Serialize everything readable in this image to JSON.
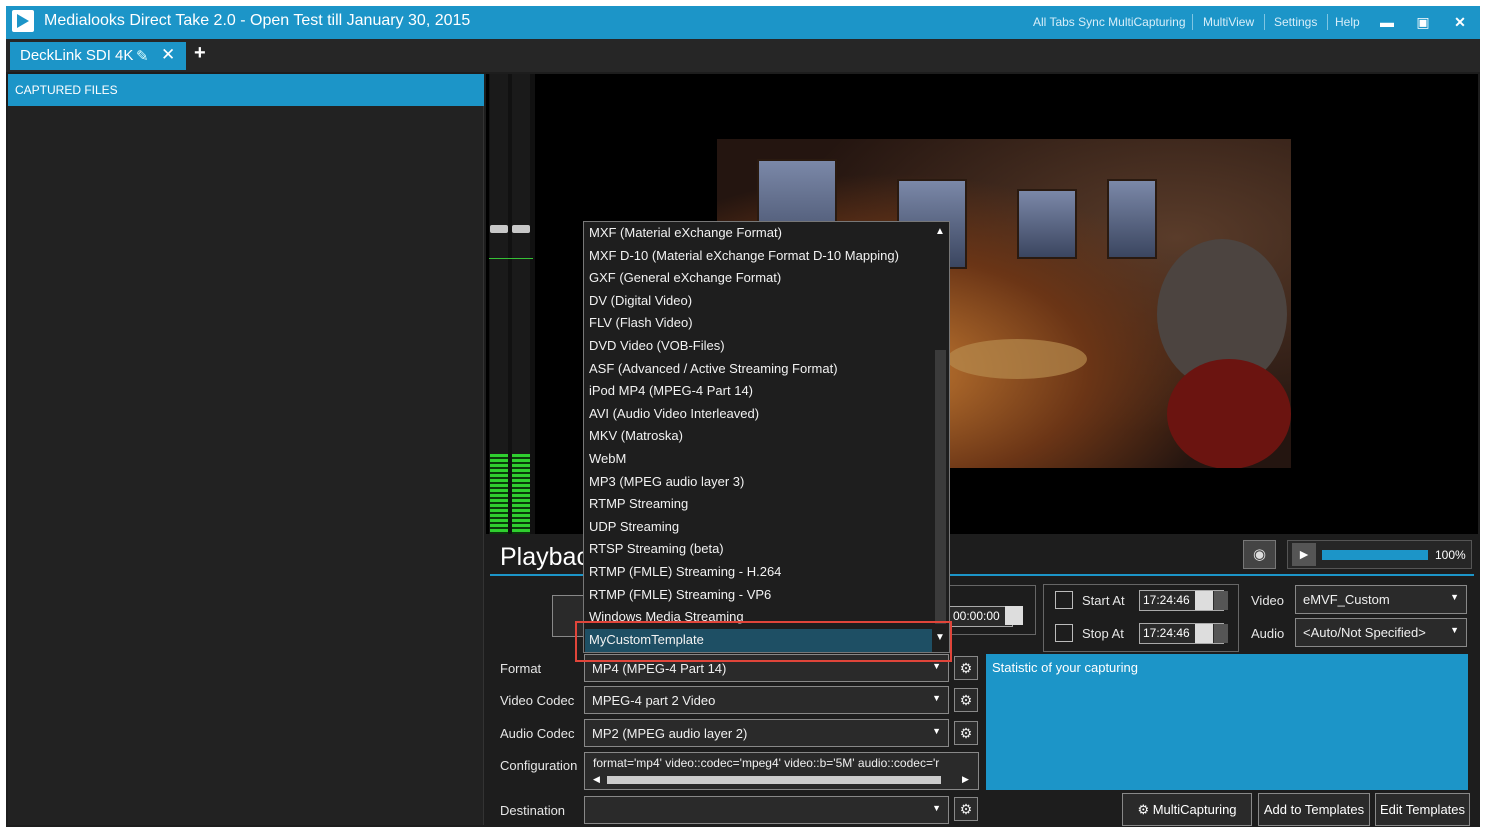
{
  "app": {
    "title": "Medialooks Direct Take 2.0 - Open Test till January 30, 2015"
  },
  "topmenu": {
    "items": [
      "All Tabs Sync MultiCapturing",
      "MultiView",
      "Settings",
      "Help"
    ]
  },
  "tab": {
    "label": "DeckLink SDI 4K"
  },
  "captured": {
    "header": "CAPTURED FILES"
  },
  "playback": {
    "title": "Playback",
    "volume": "100%"
  },
  "schedule": {
    "start_label": "Start At",
    "start_time": "17:24:46",
    "stop_label": "Stop At",
    "stop_time": "17:24:46",
    "duration": "00:00:00"
  },
  "output": {
    "video_label": "Video",
    "video_value": "eMVF_Custom",
    "audio_label": "Audio",
    "audio_value": "<Auto/Not Specified>"
  },
  "form": {
    "format_label": "Format",
    "format_value": "MP4 (MPEG-4 Part 14)",
    "video_codec_label": "Video Codec",
    "video_codec_value": "MPEG-4 part 2 Video",
    "audio_codec_label": "Audio Codec",
    "audio_codec_value": "MP2 (MPEG audio layer 2)",
    "config_label": "Configuration",
    "config_value": "format='mp4' video::codec='mpeg4' video::b='5M' audio::codec='r",
    "destination_label": "Destination",
    "destination_value": ""
  },
  "stats": {
    "label": "Statistic of your capturing"
  },
  "buttons": {
    "multicapturing": "MultiCapturing",
    "add_templates": "Add to Templates",
    "edit_templates": "Edit Templates"
  },
  "dropdown": {
    "items": [
      "MXF (Material eXchange Format)",
      "MXF D-10 (Material eXchange Format D-10 Mapping)",
      "GXF (General eXchange Format)",
      "DV (Digital Video)",
      "FLV (Flash Video)",
      "DVD Video (VOB-Files)",
      "ASF (Advanced / Active Streaming Format)",
      "iPod MP4 (MPEG-4 Part 14)",
      "AVI (Audio Video Interleaved)",
      "MKV (Matroska)",
      "WebM",
      "MP3 (MPEG audio layer 3)",
      "RTMP Streaming",
      "UDP Streaming",
      "RTSP Streaming (beta)",
      "RTMP (FMLE) Streaming - H.264",
      "RTMP (FMLE) Streaming - VP6",
      "Windows Media Streaming"
    ],
    "selected": "MyCustomTemplate"
  },
  "colors": {
    "accent": "#1c95c8",
    "highlight": "#e0453a"
  }
}
